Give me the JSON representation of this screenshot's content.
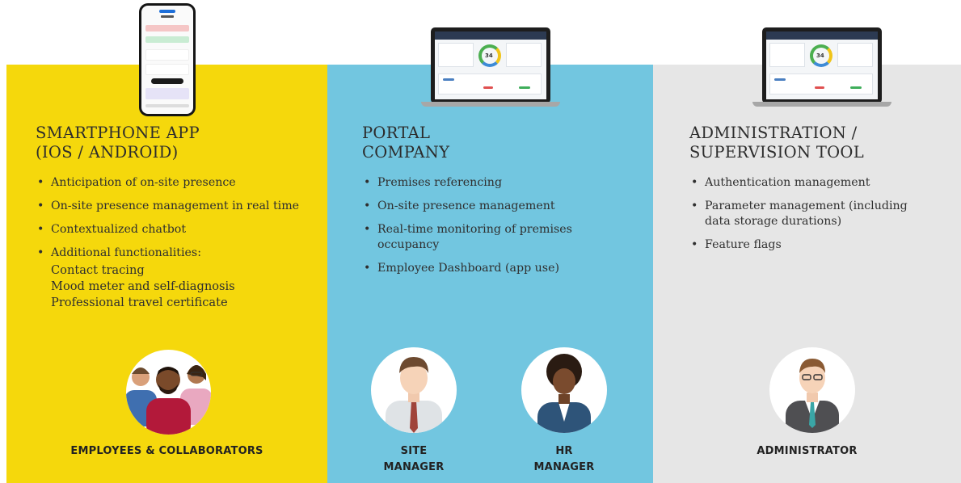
{
  "columns": {
    "app": {
      "title_line1": "SMARTPHONE APP",
      "title_line2": "(IOS / ANDROID)",
      "features": [
        "Anticipation of on-site presence",
        "On-site presence management in real time",
        "Contextualized chatbot",
        "Additional functionalities:"
      ],
      "subfeatures": [
        "Contact tracing",
        "Mood meter and self-diagnosis",
        "Professional travel certificate"
      ],
      "role": "EMPLOYEES & COLLABORATORS"
    },
    "portal": {
      "title_line1": "PORTAL",
      "title_line2": "COMPANY",
      "features": [
        "Premises referencing",
        "On-site presence management",
        "Real-time monitoring of premises occupancy",
        "Employee Dashboard (app use)"
      ],
      "role_site_line1": "SITE",
      "role_site_line2": "MANAGER",
      "role_hr_line1": "HR",
      "role_hr_line2": "MANAGER",
      "gauge_value": "34"
    },
    "admin": {
      "title_line1": "ADMINISTRATION /",
      "title_line2": "SUPERVISION TOOL",
      "features": [
        "Authentication management",
        "Parameter management (including data storage durations)",
        "Feature flags"
      ],
      "role": "ADMINISTRATOR",
      "gauge_value": "34"
    }
  },
  "colors": {
    "app_bg": "#f5d80c",
    "portal_bg": "#72c6e0",
    "admin_bg": "#e6e6e6"
  }
}
